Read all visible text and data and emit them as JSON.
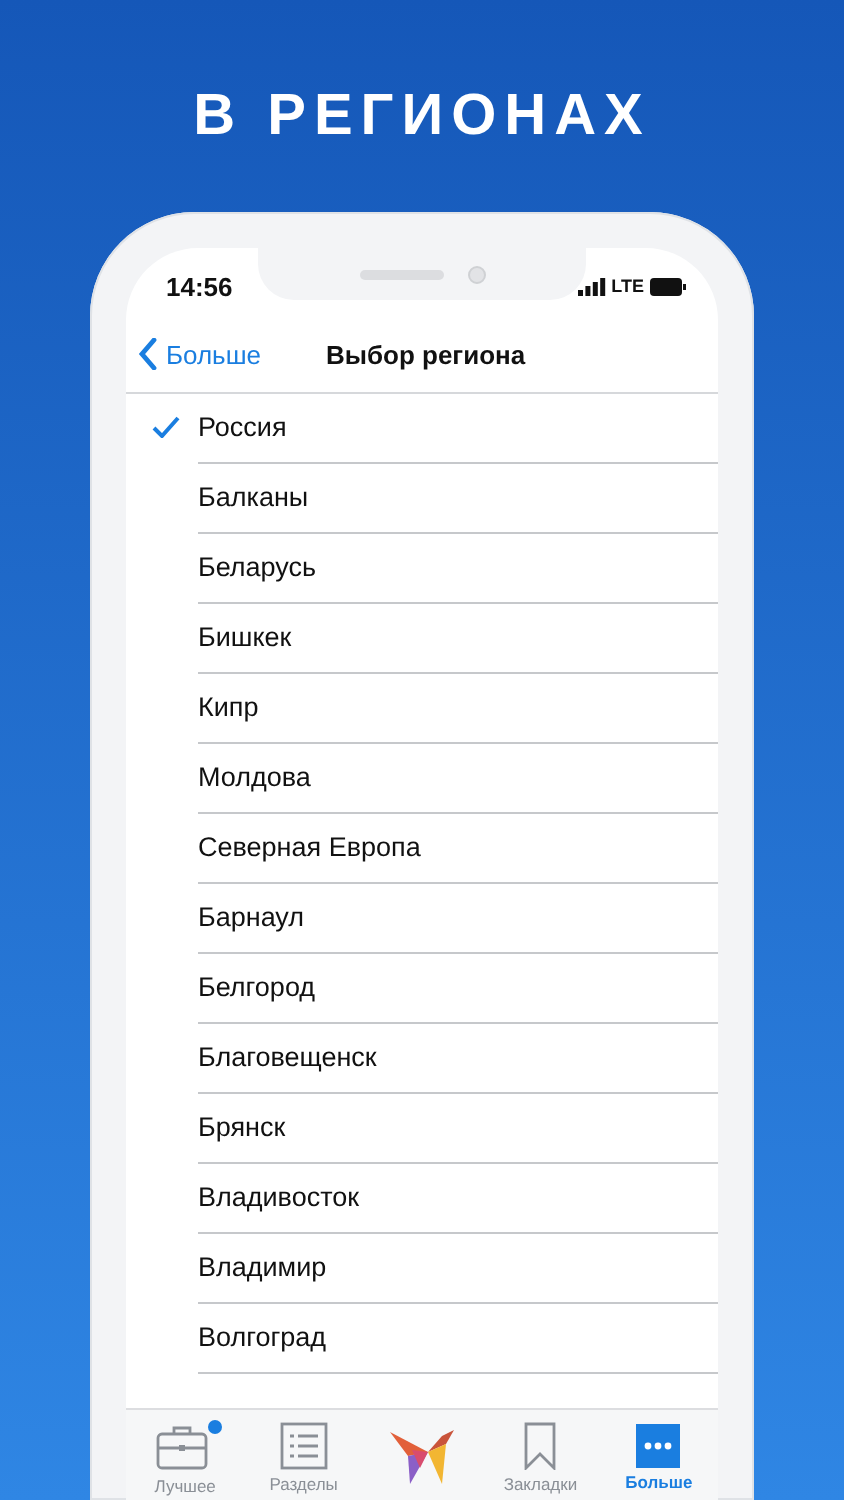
{
  "headline": "В РЕГИОНАХ",
  "status_bar": {
    "time": "14:56",
    "network": "LTE"
  },
  "nav_bar": {
    "back": "Больше",
    "title": "Выбор региона"
  },
  "regions": [
    {
      "name": "Россия",
      "selected": true
    },
    {
      "name": "Балканы",
      "selected": false
    },
    {
      "name": "Беларусь",
      "selected": false
    },
    {
      "name": "Бишкек",
      "selected": false
    },
    {
      "name": "Кипр",
      "selected": false
    },
    {
      "name": "Молдова",
      "selected": false
    },
    {
      "name": "Северная Европа",
      "selected": false
    },
    {
      "name": "Барнаул",
      "selected": false
    },
    {
      "name": "Белгород",
      "selected": false
    },
    {
      "name": "Благовещенск",
      "selected": false
    },
    {
      "name": "Брянск",
      "selected": false
    },
    {
      "name": "Владивосток",
      "selected": false
    },
    {
      "name": "Владимир",
      "selected": false
    },
    {
      "name": "Волгоград",
      "selected": false
    }
  ],
  "tab_bar": [
    {
      "kind": "briefcase",
      "label": "Лучшее",
      "selected": false,
      "badge": true
    },
    {
      "kind": "list",
      "label": "Разделы",
      "selected": false,
      "badge": false
    },
    {
      "kind": "logo"
    },
    {
      "kind": "bookmark",
      "label": "Закладки",
      "selected": false,
      "badge": false
    },
    {
      "kind": "more",
      "label": "Больше",
      "selected": true,
      "badge": false
    }
  ]
}
